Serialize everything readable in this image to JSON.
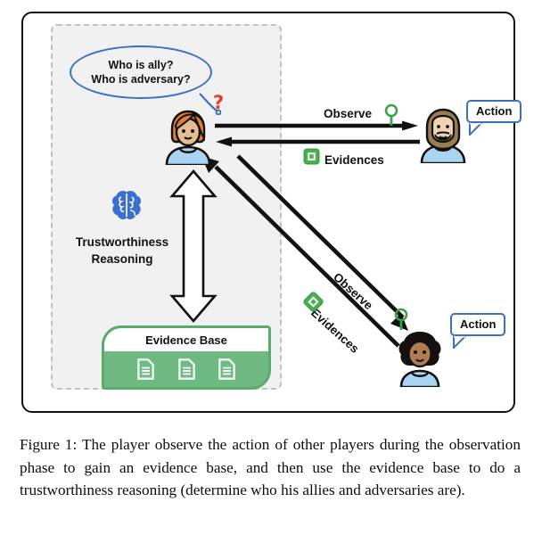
{
  "figure": {
    "caption": "Figure 1: The player observe the action of other players during the observation phase to gain an evidence base, and then use the evidence base to do a trustworthiness reasoning (determine who his allies and adversaries are).",
    "colors": {
      "accent_blue": "#3e6fc4",
      "brain_blue": "#3a6fd0",
      "evidence_green": "#4caf50",
      "card_green": "#6fb982",
      "card_green_border": "#5aab6e",
      "question_red": "#e33b2e",
      "panel_grey": "#f1f1f1",
      "dash_grey": "#c2c2c2",
      "shirt_blue": "#a9d4f2",
      "frame_black": "#111111"
    }
  },
  "player_scope": {
    "question_bubble": {
      "line1": "Who is ally?",
      "line2": "Who is adversary?",
      "icon": "speech-bubble-ellipse"
    },
    "confusion_marker": "?",
    "reasoning": {
      "icon": "brain-icon",
      "line1": "Trustworthiness",
      "line2": "Reasoning"
    },
    "evidence_base": {
      "title": "Evidence Base",
      "documents": [
        "document-icon",
        "document-icon",
        "document-icon"
      ],
      "document_count": 3
    },
    "vertical_arrow": "double-headed-vertical-arrow"
  },
  "players": [
    {
      "id": "player-self",
      "avatar": "avatar-orange-hair",
      "role": "observer"
    },
    {
      "id": "player-bearded",
      "avatar": "avatar-bearded-man",
      "bubble_label": "Action"
    },
    {
      "id": "player-curly",
      "avatar": "avatar-curly-hair",
      "bubble_label": "Action"
    }
  ],
  "edges": [
    {
      "id": "edge-observe-bearded",
      "observe_label": "Observe",
      "observe_icon": "magnifier-icon",
      "evidences_label": "Evidences",
      "evidences_icon": "evidence-badge-icon",
      "direction": "horizontal"
    },
    {
      "id": "edge-observe-curly",
      "observe_label": "Observe",
      "observe_icon": "magnifier-icon",
      "evidences_label": "Evidences",
      "evidences_icon": "evidence-badge-icon",
      "direction": "diagonal"
    }
  ]
}
